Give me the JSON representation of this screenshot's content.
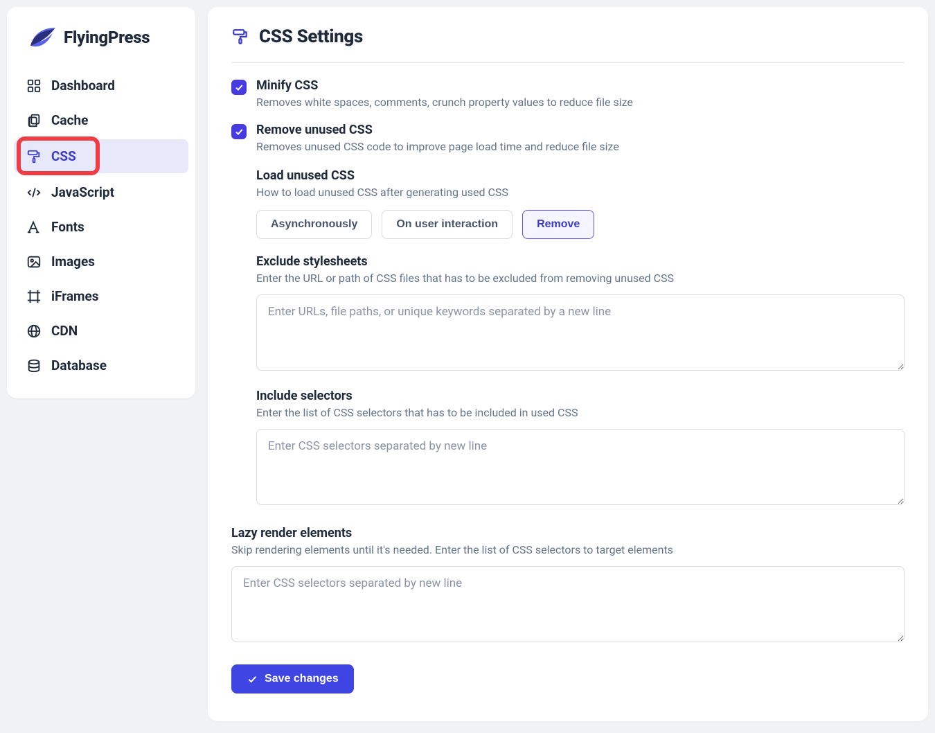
{
  "brand": {
    "name": "FlyingPress"
  },
  "sidebar": {
    "items": [
      {
        "label": "Dashboard"
      },
      {
        "label": "Cache"
      },
      {
        "label": "CSS"
      },
      {
        "label": "JavaScript"
      },
      {
        "label": "Fonts"
      },
      {
        "label": "Images"
      },
      {
        "label": "iFrames"
      },
      {
        "label": "CDN"
      },
      {
        "label": "Database"
      }
    ],
    "active_index": 2
  },
  "page": {
    "title": "CSS Settings",
    "minify": {
      "label": "Minify CSS",
      "desc": "Removes white spaces, comments, crunch property values to reduce file size",
      "checked": true
    },
    "remove_unused": {
      "label": "Remove unused CSS",
      "desc": "Removes unused CSS code to improve page load time and reduce file size",
      "checked": true,
      "load_unused": {
        "title": "Load unused CSS",
        "desc": "How to load unused CSS after generating used CSS",
        "options": [
          "Asynchronously",
          "On user interaction",
          "Remove"
        ],
        "selected_index": 2
      },
      "exclude": {
        "title": "Exclude stylesheets",
        "desc": "Enter the URL or path of CSS files that has to be excluded from removing unused CSS",
        "placeholder": "Enter URLs, file paths, or unique keywords separated by a new line",
        "value": ""
      },
      "include": {
        "title": "Include selectors",
        "desc": "Enter the list of CSS selectors that has to be included in used CSS",
        "placeholder": "Enter CSS selectors separated by new line",
        "value": ""
      }
    },
    "lazy_render": {
      "title": "Lazy render elements",
      "desc": "Skip rendering elements until it's needed. Enter the list of CSS selectors to target elements",
      "placeholder": "Enter CSS selectors separated by new line",
      "value": ""
    },
    "save_label": "Save changes"
  }
}
